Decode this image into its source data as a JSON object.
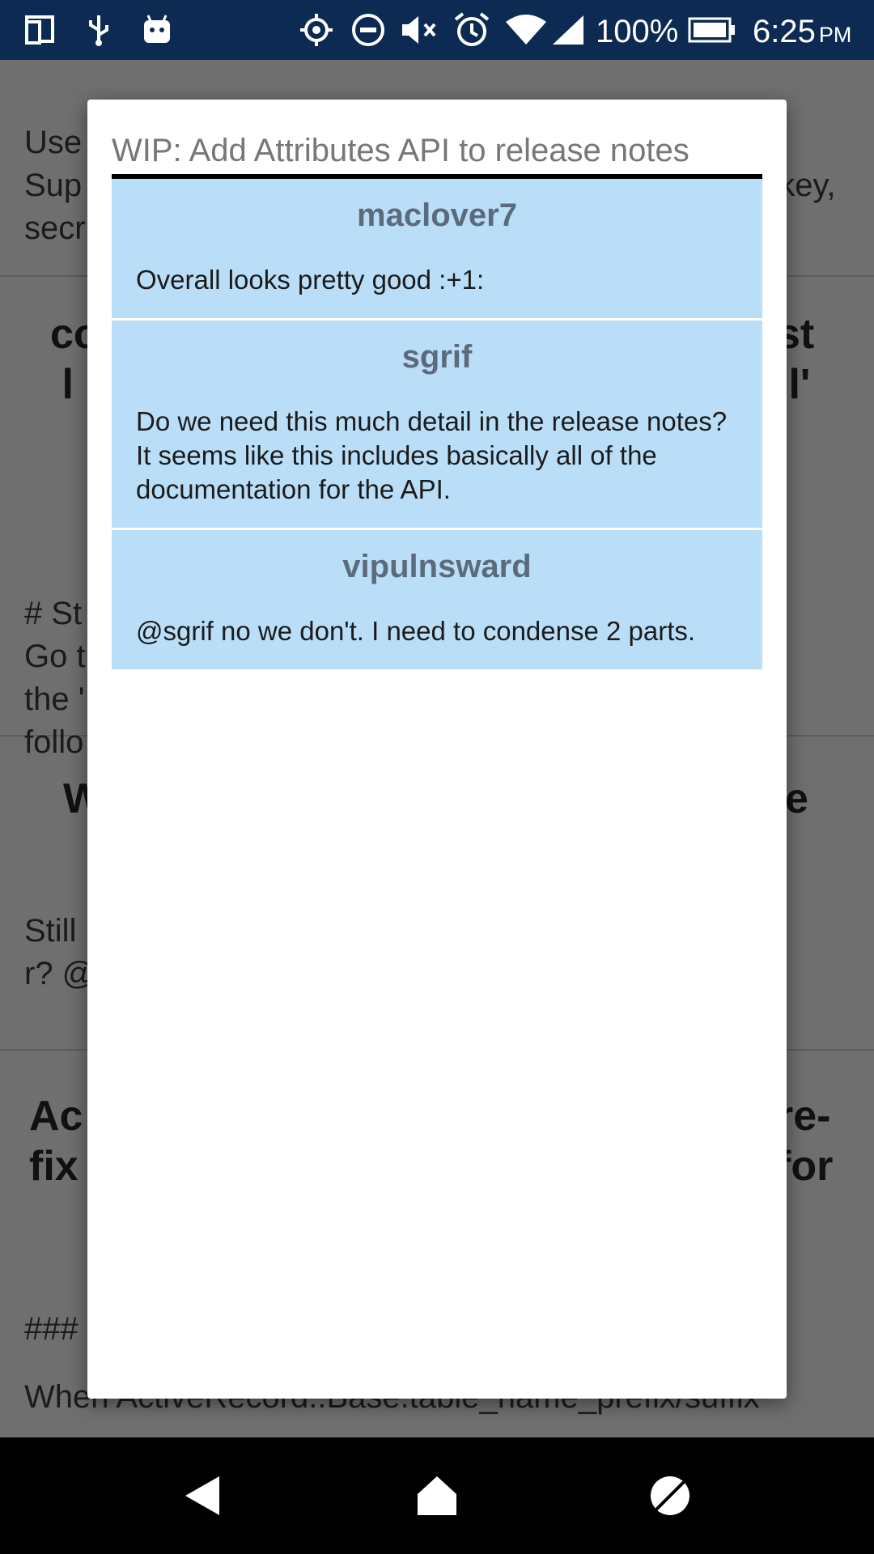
{
  "status_bar": {
    "battery_percent": "100%",
    "time": "6:25",
    "ampm": "PM",
    "icons_left": [
      "screen-icon",
      "usb-icon",
      "android-icon"
    ],
    "icons_right": [
      "location-icon",
      "do-not-disturb-icon",
      "mute-icon",
      "alarm-icon",
      "wifi-icon",
      "signal-icon",
      "battery-icon"
    ]
  },
  "background": {
    "cards": [
      {
        "text": "Use\nSup\nsecr",
        "right_text": "\n  key,\n"
      },
      {
        "title_left": "co\n l",
        "title_right": "st\n l'"
      },
      {
        "text": "# St\nGo t\nthe '\nfollo"
      },
      {
        "title_left": "W",
        "title_right": "e"
      },
      {
        "text": "Still\nr? @"
      },
      {
        "title_left": "Ac\nfix",
        "title_right": "re-\nfor"
      },
      {
        "text": "###"
      }
    ],
    "bottom_line": "When ActiveRecord::Base.table_name_prefix/suffix"
  },
  "dialog": {
    "title": "WIP: Add Attributes API to release notes",
    "comments": [
      {
        "author": "maclover7",
        "body": "Overall looks pretty good :+1:"
      },
      {
        "author": "sgrif",
        "body": "Do we need this much detail in the release notes? It seems like this includes basically all of the documentation for the API."
      },
      {
        "author": "vipulnsward",
        "body": "@sgrif no we don't. I need to condense 2 parts."
      }
    ]
  },
  "nav_bar": {
    "buttons": [
      "back-icon",
      "home-icon",
      "recents-icon"
    ]
  },
  "colors": {
    "status_bar": "#0d2a52",
    "comment_bg": "#bbdef8",
    "author_text": "#5b6b7b",
    "scrim": "#6f6f6f"
  }
}
